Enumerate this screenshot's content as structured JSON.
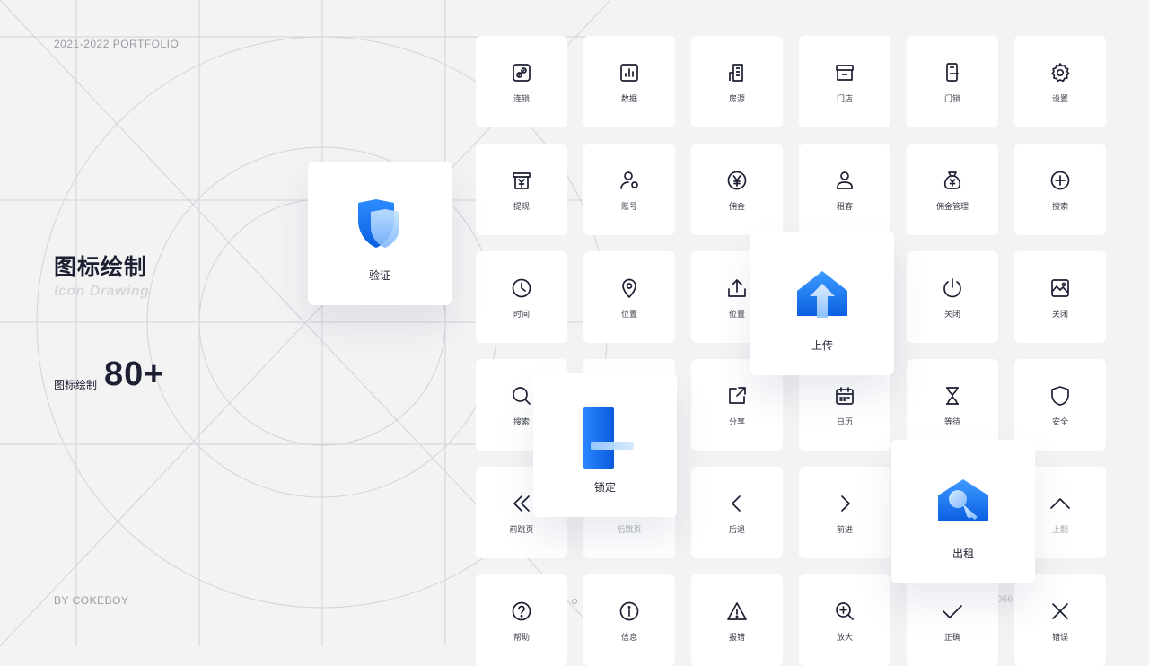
{
  "header": {
    "portfolio": "2021-2022 PORTFOLIO"
  },
  "footer": {
    "author": "BY COKEBOY"
  },
  "hero": {
    "title": "图标绘制",
    "subtitle": "Icon Drawing",
    "stat_label": "图标绘制",
    "stat_value": "80+"
  },
  "page_marks": {
    "left": "0",
    "right": "066"
  },
  "colors": {
    "accent": "#1a73f0",
    "accent_light": "#8fc4ff",
    "ink": "#1d1f33",
    "tile": "#ffffff",
    "bg": "#f3f3f4"
  },
  "tiles": [
    {
      "label": "连锁",
      "icon": "link-icon"
    },
    {
      "label": "数据",
      "icon": "chart-icon"
    },
    {
      "label": "房源",
      "icon": "building-icon"
    },
    {
      "label": "门店",
      "icon": "store-icon"
    },
    {
      "label": "门锁",
      "icon": "door-lock-icon"
    },
    {
      "label": "设置",
      "icon": "gear-icon"
    },
    {
      "label": "提现",
      "icon": "withdraw-icon"
    },
    {
      "label": "账号",
      "icon": "account-icon"
    },
    {
      "label": "佣金",
      "icon": "yen-coin-icon"
    },
    {
      "label": "租客",
      "icon": "tenant-icon"
    },
    {
      "label": "佣金管理",
      "icon": "money-bag-icon"
    },
    {
      "label": "搜索",
      "icon": "plus-circle-icon"
    },
    {
      "label": "时间",
      "icon": "clock-icon"
    },
    {
      "label": "位置",
      "icon": "location-pin-icon"
    },
    {
      "label": "位置",
      "icon": "upload-tray-icon"
    },
    {
      "label": "上传",
      "icon": "upload-icon"
    },
    {
      "label": "关闭",
      "icon": "power-icon"
    },
    {
      "label": "关闭",
      "icon": "image-icon"
    },
    {
      "label": "搜索",
      "icon": "search-icon"
    },
    {
      "label": "",
      "icon": "blank-icon"
    },
    {
      "label": "分享",
      "icon": "share-icon"
    },
    {
      "label": "日历",
      "icon": "calendar-icon"
    },
    {
      "label": "等待",
      "icon": "hourglass-icon"
    },
    {
      "label": "安全",
      "icon": "shield-icon"
    },
    {
      "label": "前跳页",
      "icon": "double-chevron-left-icon"
    },
    {
      "label": "后跳页",
      "icon": "double-chevron-right-icon"
    },
    {
      "label": "后退",
      "icon": "chevron-left-icon"
    },
    {
      "label": "前进",
      "icon": "chevron-right-icon"
    },
    {
      "label": "",
      "icon": "chevron-down-icon"
    },
    {
      "label": "上翻",
      "icon": "chevron-up-icon"
    },
    {
      "label": "帮助",
      "icon": "help-icon"
    },
    {
      "label": "信息",
      "icon": "info-icon"
    },
    {
      "label": "报错",
      "icon": "warning-icon"
    },
    {
      "label": "放大",
      "icon": "zoom-in-icon"
    },
    {
      "label": "正确",
      "icon": "check-icon"
    },
    {
      "label": "错误",
      "icon": "close-icon"
    }
  ],
  "featured": [
    {
      "label": "验证",
      "icon": "shield-verify-icon"
    },
    {
      "label": "上传",
      "icon": "upload-house-icon"
    },
    {
      "label": "锁定",
      "icon": "door-lock-3d-icon"
    },
    {
      "label": "出租",
      "icon": "rent-key-house-icon"
    }
  ]
}
